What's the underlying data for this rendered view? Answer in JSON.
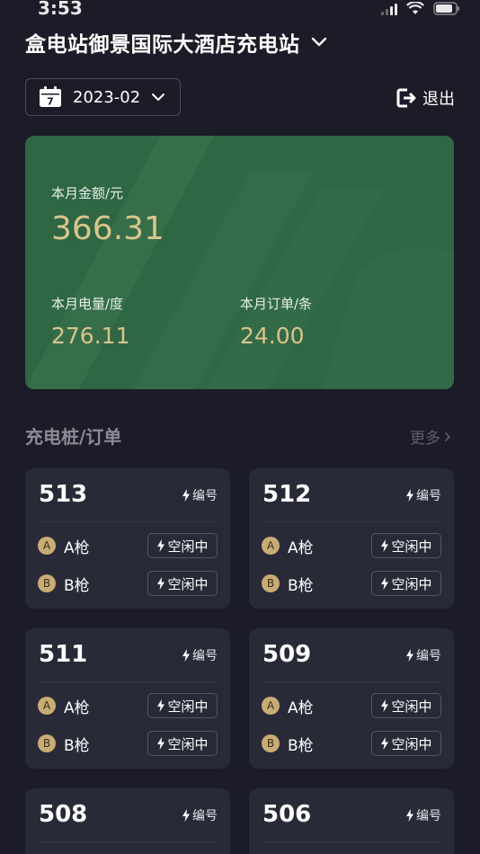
{
  "status_bar": {
    "time": "3:53"
  },
  "header": {
    "station_name": "盒电站御景国际大酒店充电站"
  },
  "month_picker": {
    "value": "2023-02",
    "calendar_day": "7"
  },
  "logout": {
    "label": "退出"
  },
  "summary": {
    "amount_label": "本月金额/元",
    "amount_value": "366.31",
    "energy_label": "本月电量/度",
    "energy_value": "276.11",
    "orders_label": "本月订单/条",
    "orders_value": "24.00"
  },
  "section": {
    "title": "充电桩/订单",
    "more": "更多"
  },
  "piles": [
    {
      "id": "513",
      "code_label": "编号",
      "gun_a_badge": "A",
      "gun_a": "A枪",
      "gun_a_status": "空闲中",
      "gun_b_badge": "B",
      "gun_b": "B枪",
      "gun_b_status": "空闲中"
    },
    {
      "id": "512",
      "code_label": "编号",
      "gun_a_badge": "A",
      "gun_a": "A枪",
      "gun_a_status": "空闲中",
      "gun_b_badge": "B",
      "gun_b": "B枪",
      "gun_b_status": "空闲中"
    },
    {
      "id": "511",
      "code_label": "编号",
      "gun_a_badge": "A",
      "gun_a": "A枪",
      "gun_a_status": "空闲中",
      "gun_b_badge": "B",
      "gun_b": "B枪",
      "gun_b_status": "空闲中"
    },
    {
      "id": "509",
      "code_label": "编号",
      "gun_a_badge": "A",
      "gun_a": "A枪",
      "gun_a_status": "空闲中",
      "gun_b_badge": "B",
      "gun_b": "B枪",
      "gun_b_status": "空闲中"
    },
    {
      "id": "508",
      "code_label": "编号"
    },
    {
      "id": "506",
      "code_label": "编号"
    }
  ],
  "colors": {
    "background": "#1b1c27",
    "summary_card": "#2f6644",
    "gold_value": "#d8c58a",
    "card": "#282a38",
    "gun_badge": "#c9ab74"
  },
  "icons": {
    "calendar": "calendar-icon",
    "chevron": "chevron-down-icon",
    "logout": "logout-icon",
    "lightning": "lightning-icon",
    "more": "chevron-right-icon"
  }
}
